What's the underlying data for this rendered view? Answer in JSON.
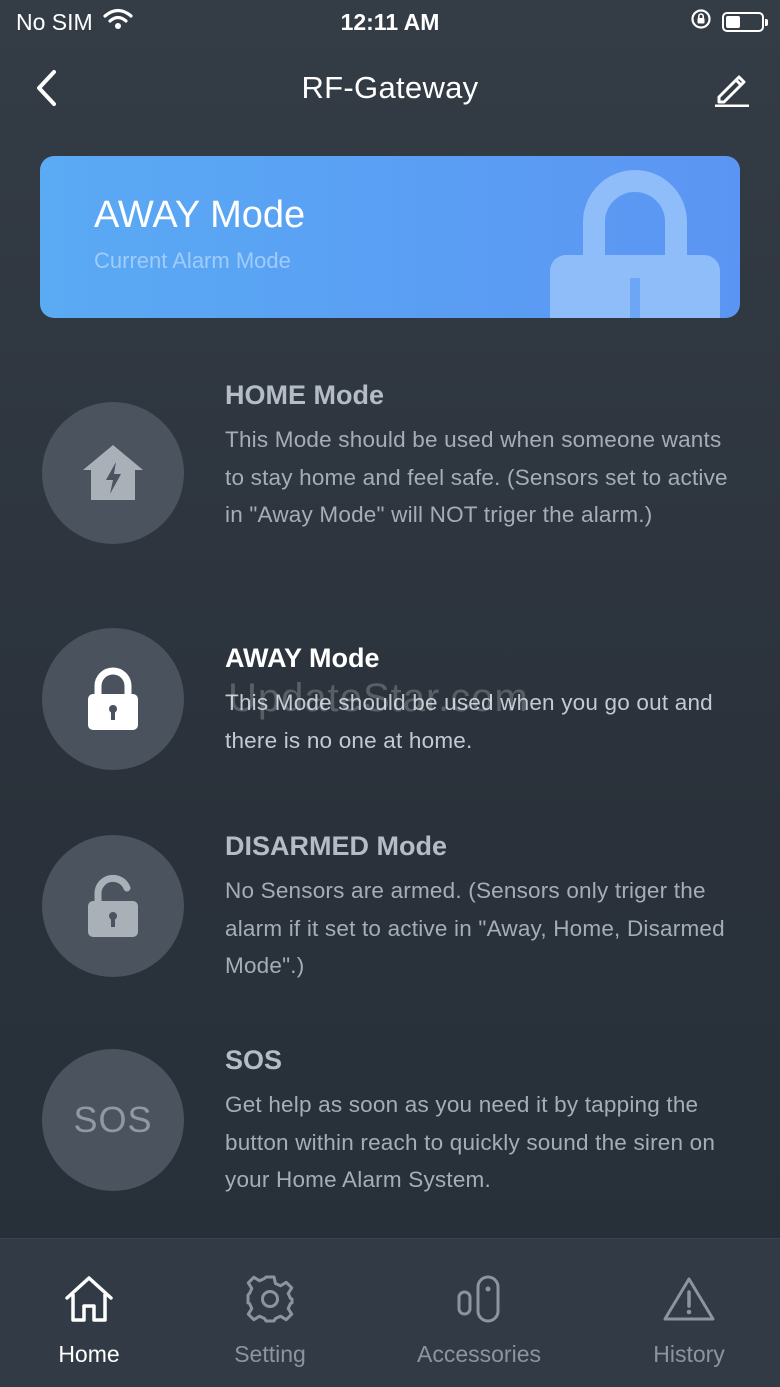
{
  "status_bar": {
    "carrier": "No SIM",
    "time": "12:11 AM"
  },
  "nav": {
    "title": "RF-Gateway"
  },
  "current_mode": {
    "title": "AWAY Mode",
    "subtitle": "Current Alarm Mode"
  },
  "modes": [
    {
      "title": "HOME Mode",
      "description": "This Mode should be used when someone wants to stay home and feel safe. (Sensors set to active in \"Away Mode\" will NOT triger the alarm.)",
      "icon": "home-bolt-icon",
      "active": false
    },
    {
      "title": "AWAY Mode",
      "description": "This Mode should be used when you go out and there is no one at home.",
      "icon": "lock-icon",
      "active": true
    },
    {
      "title": "DISARMED Mode",
      "description": "No Sensors are armed. (Sensors only triger the alarm if it set to active in \"Away, Home, Disarmed Mode\".)",
      "icon": "unlock-icon",
      "active": false
    },
    {
      "title": "SOS",
      "description": "Get help as soon as you need it by tapping the button within reach to quickly sound the siren on your Home Alarm System.",
      "icon_text": "SOS",
      "active": false
    }
  ],
  "watermark": "UpdateStar.com",
  "tabs": [
    {
      "label": "Home",
      "icon": "home-icon",
      "active": true
    },
    {
      "label": "Setting",
      "icon": "gear-icon",
      "active": false
    },
    {
      "label": "Accessories",
      "icon": "accessories-icon",
      "active": false
    },
    {
      "label": "History",
      "icon": "warning-icon",
      "active": false
    }
  ],
  "colors": {
    "background": "#2f3640",
    "card_gradient_start": "#5aaaf4",
    "card_gradient_end": "#5b95f3",
    "circle": "#4a535e",
    "tab_bar": "#323b45"
  }
}
